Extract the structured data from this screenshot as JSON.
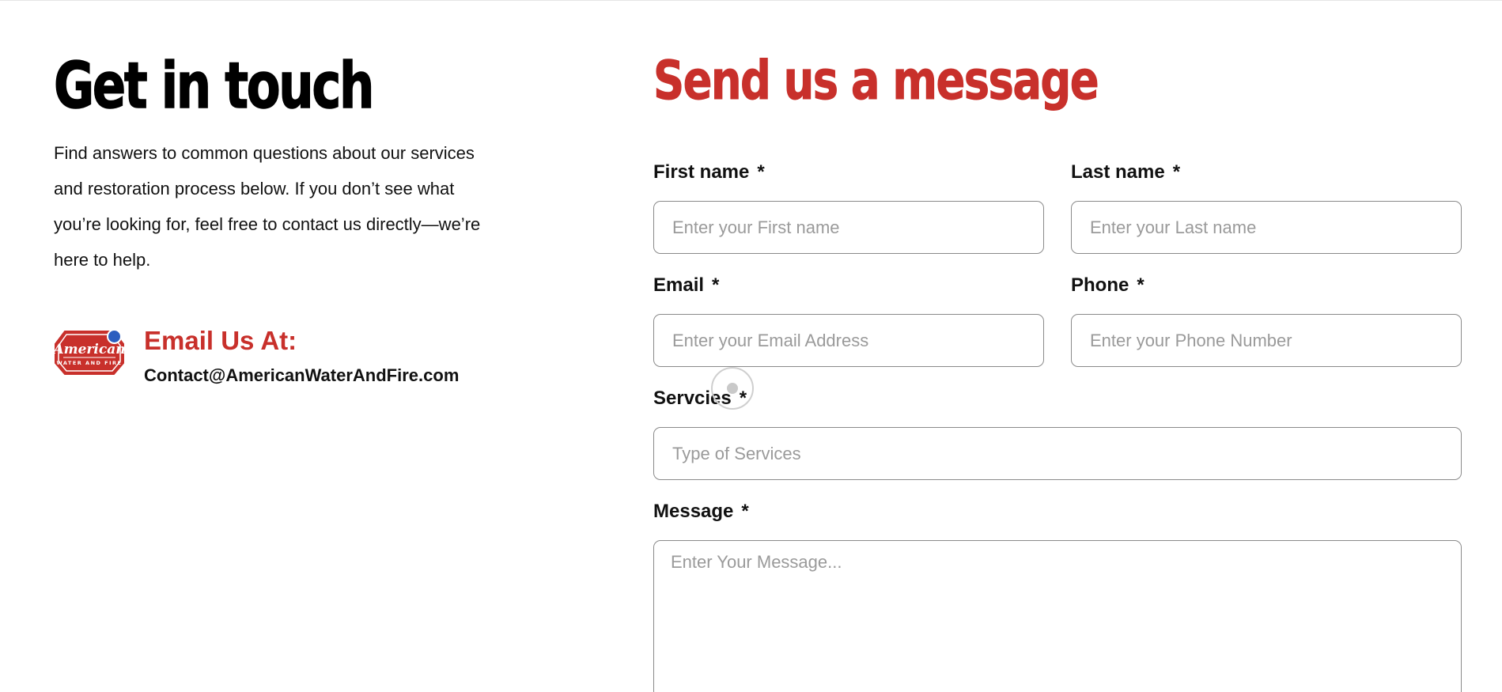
{
  "contact_info": {
    "title": "Get in touch",
    "description": "Find answers to common questions about our services and restoration process below. If you don’t see what you’re looking for, feel free to contact us directly—we’re here to help.",
    "email_heading": "Email Us At:",
    "email_address": "Contact@AmericanWaterAndFire.com",
    "logo": {
      "icon": "american-water-and-fire-logo",
      "wordmark": "American",
      "tagline": "WATER AND FIRE"
    }
  },
  "form": {
    "title": "Send us a message",
    "required_marker": "*",
    "first_name": {
      "label": "First name",
      "placeholder": "Enter your First name",
      "value": ""
    },
    "last_name": {
      "label": "Last name",
      "placeholder": "Enter your Last name",
      "value": ""
    },
    "email": {
      "label": "Email",
      "placeholder": "Enter your Email Address",
      "value": ""
    },
    "phone": {
      "label": "Phone",
      "placeholder": "Enter your Phone Number",
      "value": ""
    },
    "services": {
      "label": "Servcies",
      "placeholder": "Type of Services",
      "value": ""
    },
    "message": {
      "label": "Message",
      "placeholder": "Enter Your Message...",
      "value": ""
    }
  },
  "colors": {
    "accent": "#c8302b",
    "text": "#111111",
    "placeholder": "#9a9a9a",
    "input_border": "#8a8a8a",
    "logo_dot": "#2a5dbf"
  }
}
